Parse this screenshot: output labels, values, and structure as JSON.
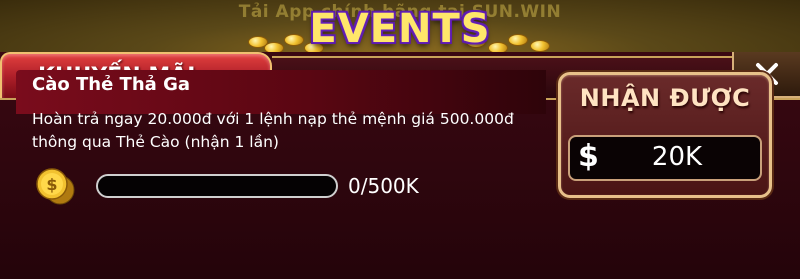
{
  "header": {
    "banner_text": "Tải App chính hãng tại  SUN.WIN",
    "events_title": "EVENTS"
  },
  "tabs": {
    "active_label": "KHUYẾN MÃI"
  },
  "event": {
    "title": "Cào Thẻ Thả Ga",
    "description_line1": "Hoàn trả ngay 20.000đ với 1 lệnh nạp thẻ mệnh giá 500.000đ",
    "description_line2": "thông qua Thẻ Cào (nhận 1 lần)",
    "progress_text": "0/500K",
    "progress_fraction": 0
  },
  "reward": {
    "title": "NHẬN ĐƯỢC",
    "currency_symbol": "$",
    "amount": "20K"
  },
  "colors": {
    "accent_gold": "#f0c070",
    "tab_red": "#b0202a",
    "panel_bg": "#2a060c"
  },
  "icons": {
    "close": "close-icon",
    "coin": "coin-icon",
    "dollar": "dollar-icon"
  }
}
